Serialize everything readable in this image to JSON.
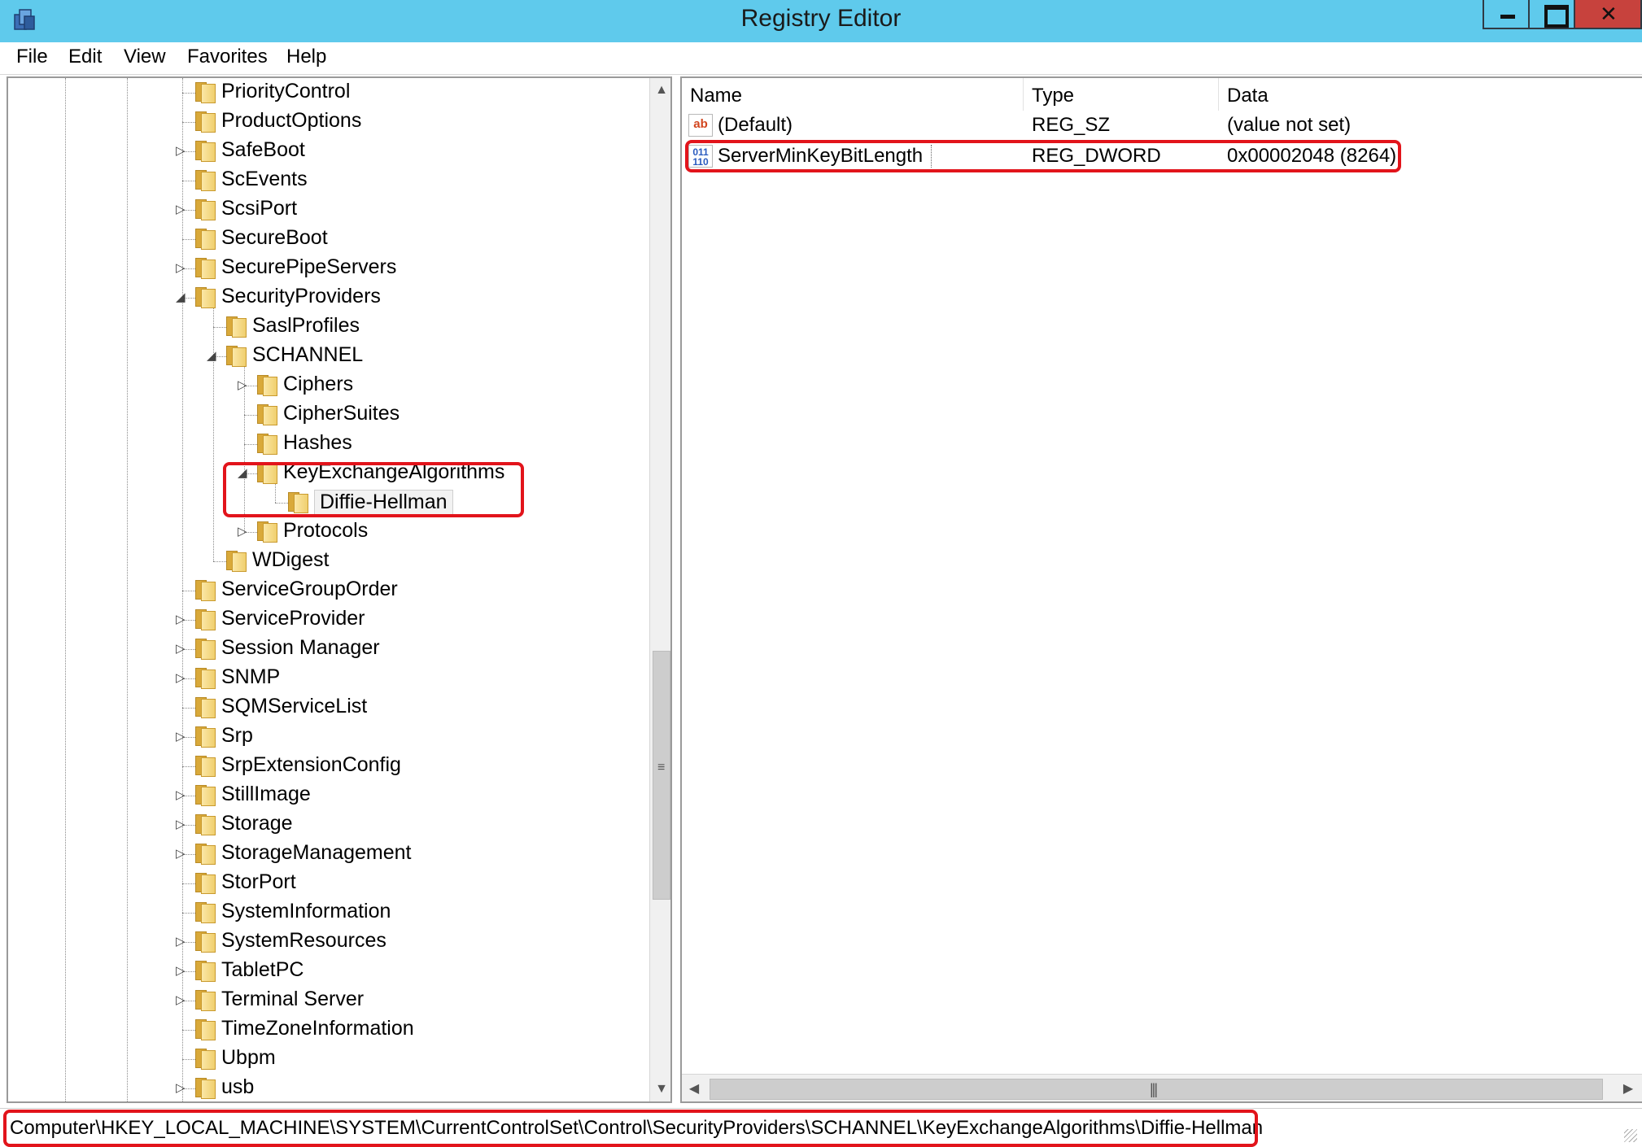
{
  "window": {
    "title": "Registry Editor",
    "icon": "regedit-icon"
  },
  "menu": [
    "File",
    "Edit",
    "View",
    "Favorites",
    "Help"
  ],
  "tree": {
    "nodes": [
      {
        "label": "PriorityControl",
        "level": 0,
        "expander": "none"
      },
      {
        "label": "ProductOptions",
        "level": 0,
        "expander": "none"
      },
      {
        "label": "SafeBoot",
        "level": 0,
        "expander": "collapsed"
      },
      {
        "label": "ScEvents",
        "level": 0,
        "expander": "none"
      },
      {
        "label": "ScsiPort",
        "level": 0,
        "expander": "collapsed"
      },
      {
        "label": "SecureBoot",
        "level": 0,
        "expander": "none"
      },
      {
        "label": "SecurePipeServers",
        "level": 0,
        "expander": "collapsed"
      },
      {
        "label": "SecurityProviders",
        "level": 0,
        "expander": "expanded"
      },
      {
        "label": "SaslProfiles",
        "level": 1,
        "expander": "none"
      },
      {
        "label": "SCHANNEL",
        "level": 1,
        "expander": "expanded"
      },
      {
        "label": "Ciphers",
        "level": 2,
        "expander": "collapsed"
      },
      {
        "label": "CipherSuites",
        "level": 2,
        "expander": "none"
      },
      {
        "label": "Hashes",
        "level": 2,
        "expander": "none"
      },
      {
        "label": "KeyExchangeAlgorithms",
        "level": 2,
        "expander": "expanded"
      },
      {
        "label": "Diffie-Hellman",
        "level": 3,
        "expander": "none",
        "selected": true
      },
      {
        "label": "Protocols",
        "level": 2,
        "expander": "collapsed"
      },
      {
        "label": "WDigest",
        "level": 1,
        "expander": "none"
      },
      {
        "label": "ServiceGroupOrder",
        "level": 0,
        "expander": "none"
      },
      {
        "label": "ServiceProvider",
        "level": 0,
        "expander": "collapsed"
      },
      {
        "label": "Session Manager",
        "level": 0,
        "expander": "collapsed"
      },
      {
        "label": "SNMP",
        "level": 0,
        "expander": "collapsed"
      },
      {
        "label": "SQMServiceList",
        "level": 0,
        "expander": "none"
      },
      {
        "label": "Srp",
        "level": 0,
        "expander": "collapsed"
      },
      {
        "label": "SrpExtensionConfig",
        "level": 0,
        "expander": "none"
      },
      {
        "label": "StillImage",
        "level": 0,
        "expander": "collapsed"
      },
      {
        "label": "Storage",
        "level": 0,
        "expander": "collapsed"
      },
      {
        "label": "StorageManagement",
        "level": 0,
        "expander": "collapsed"
      },
      {
        "label": "StorPort",
        "level": 0,
        "expander": "none"
      },
      {
        "label": "SystemInformation",
        "level": 0,
        "expander": "none"
      },
      {
        "label": "SystemResources",
        "level": 0,
        "expander": "collapsed"
      },
      {
        "label": "TabletPC",
        "level": 0,
        "expander": "collapsed"
      },
      {
        "label": "Terminal Server",
        "level": 0,
        "expander": "collapsed"
      },
      {
        "label": "TimeZoneInformation",
        "level": 0,
        "expander": "none"
      },
      {
        "label": "Ubpm",
        "level": 0,
        "expander": "none"
      },
      {
        "label": "usb",
        "level": 0,
        "expander": "collapsed"
      }
    ]
  },
  "list": {
    "columns": [
      "Name",
      "Type",
      "Data"
    ],
    "rows": [
      {
        "icon": "string-value-icon",
        "name": "(Default)",
        "type": "REG_SZ",
        "data": "(value not set)"
      },
      {
        "icon": "dword-value-icon",
        "name": "ServerMinKeyBitLength",
        "type": "REG_DWORD",
        "data": "0x00002048 (8264)"
      }
    ]
  },
  "status": {
    "path": "Computer\\HKEY_LOCAL_MACHINE\\SYSTEM\\CurrentControlSet\\Control\\SecurityProviders\\SCHANNEL\\KeyExchangeAlgorithms\\Diffie-Hellman"
  },
  "annotations": {
    "highlight_color": "#e2141b"
  }
}
